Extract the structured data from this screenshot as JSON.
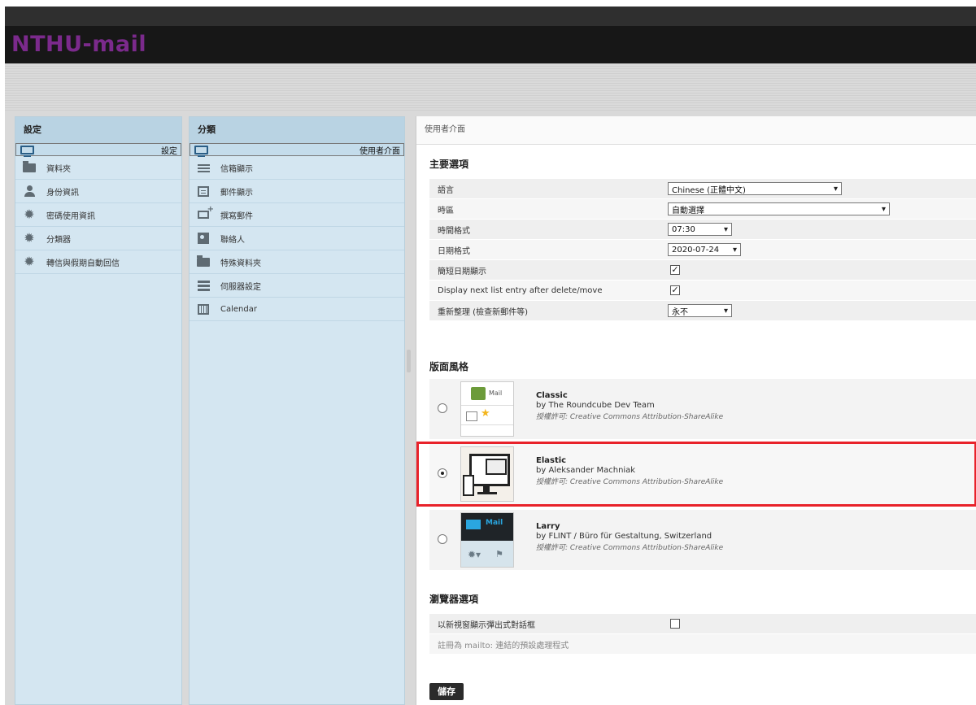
{
  "app": {
    "logo": "NTHU-mail"
  },
  "left_column": {
    "title": "設定",
    "items": [
      {
        "label": "設定",
        "icon": "screen-icon",
        "selected": true
      },
      {
        "label": "資料夾",
        "icon": "folder-icon"
      },
      {
        "label": "身份資訊",
        "icon": "person-icon"
      },
      {
        "label": "密碼使用資訊",
        "icon": "gear-icon"
      },
      {
        "label": "分類器",
        "icon": "gear-icon"
      },
      {
        "label": "轉信與假期自動回信",
        "icon": "gear-icon"
      }
    ]
  },
  "middle_column": {
    "title": "分類",
    "items": [
      {
        "label": "使用者介面",
        "icon": "screen-icon",
        "selected": true
      },
      {
        "label": "信箱顯示",
        "icon": "list-icon"
      },
      {
        "label": "郵件顯示",
        "icon": "box-icon"
      },
      {
        "label": "撰寫郵件",
        "icon": "mail-plus-icon"
      },
      {
        "label": "聯絡人",
        "icon": "contact-card-icon"
      },
      {
        "label": "特殊資料夾",
        "icon": "folder-icon"
      },
      {
        "label": "伺服器設定",
        "icon": "server-icon"
      },
      {
        "label": "Calendar",
        "icon": "calendar-icon"
      }
    ]
  },
  "main": {
    "header": "使用者介面",
    "main_options_title": "主要選項",
    "options": [
      {
        "label": "語言",
        "value": "Chinese (正體中文)"
      },
      {
        "label": "時區",
        "value": "自動選擇"
      },
      {
        "label": "時間格式",
        "value": "07:30"
      },
      {
        "label": "日期格式",
        "value": "2020-07-24"
      },
      {
        "label": "簡短日期顯示",
        "checked": true
      },
      {
        "label": "Display next list entry after delete/move",
        "checked": true
      },
      {
        "label": "重新整理 (檢查新郵件等)",
        "value": "永不"
      }
    ],
    "skin_title": "版面風格",
    "skins": [
      {
        "name": "Classic",
        "by": "by The Roundcube Dev Team",
        "license": "授權許可: Creative Commons Attribution-ShareAlike",
        "selected": false,
        "thumb_label": "Mail"
      },
      {
        "name": "Elastic",
        "by": "by Aleksander Machniak",
        "license": "授權許可: Creative Commons Attribution-ShareAlike",
        "selected": true
      },
      {
        "name": "Larry",
        "by": "by FLINT / Büro für Gestaltung, Switzerland",
        "license": "授權許可: Creative Commons Attribution-ShareAlike",
        "selected": false,
        "thumb_label": "Mail"
      }
    ],
    "browser_title": "瀏覽器選項",
    "browser_options": [
      {
        "label": "以新視窗顯示彈出式對話框",
        "checked": false
      },
      {
        "label": "註冊為 mailto: 連結的預設處理程式"
      }
    ],
    "save_label": "儲存"
  },
  "colors": {
    "highlight": "#e8222a",
    "logo": "#7b2a8c",
    "sidebar": "#d4e6f1"
  }
}
